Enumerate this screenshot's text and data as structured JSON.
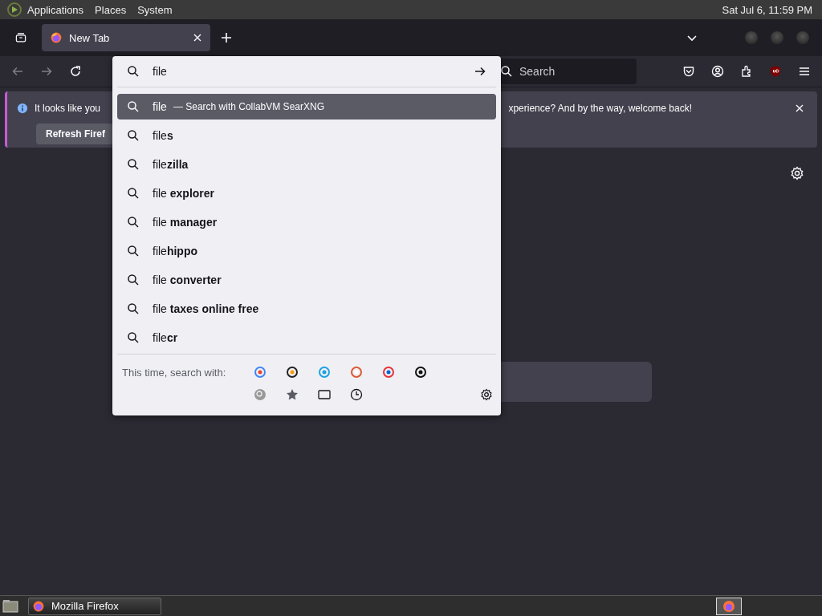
{
  "top_panel": {
    "menus": [
      "Applications",
      "Places",
      "System"
    ],
    "clock": "Sat Jul  6, 11:59 PM"
  },
  "tabs": [
    {
      "label": "New Tab",
      "selected": true
    }
  ],
  "toolbar": {
    "back_disabled": true,
    "forward_disabled": true,
    "search_placeholder": "Search"
  },
  "notification": {
    "text_start": "It looks like you",
    "text_end": "xperience? And by the way, welcome back!",
    "button": "Refresh Firef"
  },
  "urlbar": {
    "value": "file"
  },
  "suggestions": [
    {
      "text": "file",
      "action": "— Search with CollabVM SearXNG",
      "selected": true
    },
    {
      "text": "file**s**",
      "selected": false
    },
    {
      "text": "file**zilla**",
      "selected": false
    },
    {
      "text": "file **explorer**",
      "selected": false
    },
    {
      "text": "file **manager**",
      "selected": false
    },
    {
      "text": "file**hippo**",
      "selected": false
    },
    {
      "text": "file **converter**",
      "selected": false
    },
    {
      "text": "file **taxes online free**",
      "selected": false
    },
    {
      "text": "file**cr**",
      "selected": false
    }
  ],
  "one_off": {
    "label": "This time, search with:"
  },
  "taskbar": {
    "windows": [
      {
        "title": "Mozilla Firefox",
        "selected": true
      }
    ]
  }
}
